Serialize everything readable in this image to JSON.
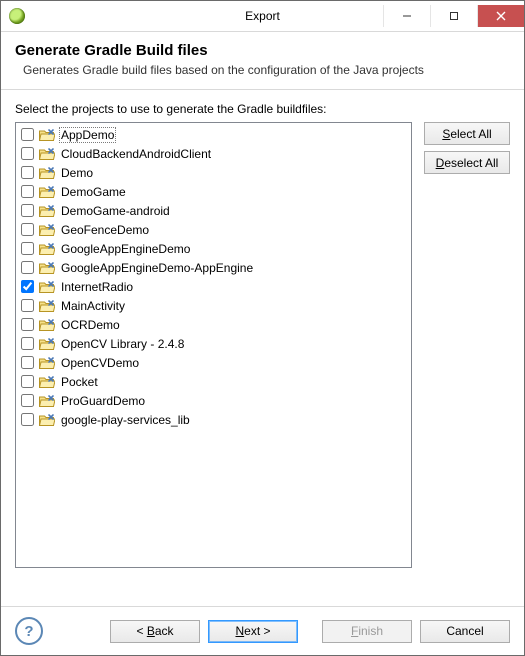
{
  "window": {
    "title": "Export"
  },
  "header": {
    "title": "Generate Gradle Build files",
    "desc": "Generates Gradle build files based on the configuration of the Java projects"
  },
  "body": {
    "prompt": "Select the projects to use to generate the Gradle buildfiles:",
    "projects": [
      {
        "name": "AppDemo",
        "checked": false,
        "selected": true
      },
      {
        "name": "CloudBackendAndroidClient",
        "checked": false
      },
      {
        "name": "Demo",
        "checked": false
      },
      {
        "name": "DemoGame",
        "checked": false
      },
      {
        "name": "DemoGame-android",
        "checked": false
      },
      {
        "name": "GeoFenceDemo",
        "checked": false
      },
      {
        "name": "GoogleAppEngineDemo",
        "checked": false
      },
      {
        "name": "GoogleAppEngineDemo-AppEngine",
        "checked": false
      },
      {
        "name": "InternetRadio",
        "checked": true
      },
      {
        "name": "MainActivity",
        "checked": false
      },
      {
        "name": "OCRDemo",
        "checked": false
      },
      {
        "name": "OpenCV Library - 2.4.8",
        "checked": false
      },
      {
        "name": "OpenCVDemo",
        "checked": false
      },
      {
        "name": "Pocket",
        "checked": false
      },
      {
        "name": "ProGuardDemo",
        "checked": false
      },
      {
        "name": "google-play-services_lib",
        "checked": false
      }
    ],
    "select_all_prefix": "S",
    "select_all_rest": "elect All",
    "deselect_all_prefix": "D",
    "deselect_all_rest": "eselect All"
  },
  "footer": {
    "help": "?",
    "back_prefix": "< ",
    "back_ul": "B",
    "back_rest": "ack",
    "next_ul": "N",
    "next_rest": "ext >",
    "finish_ul": "F",
    "finish_rest": "inish",
    "cancel": "Cancel"
  }
}
